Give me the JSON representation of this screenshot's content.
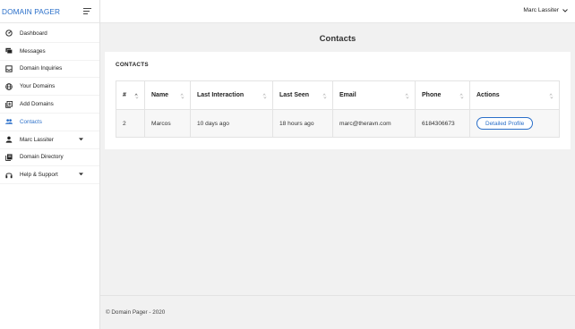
{
  "brand": {
    "name": "DOMAIN PAGER"
  },
  "sidebar": {
    "items": [
      {
        "label": "Dashboard",
        "icon": "dashboard-icon",
        "active": false,
        "has_caret": false
      },
      {
        "label": "Messages",
        "icon": "messages-icon",
        "active": false,
        "has_caret": false
      },
      {
        "label": "Domain Inquiries",
        "icon": "inquiries-icon",
        "active": false,
        "has_caret": false
      },
      {
        "label": "Your Domains",
        "icon": "globe-icon",
        "active": false,
        "has_caret": false
      },
      {
        "label": "Add Domains",
        "icon": "add-domain-icon",
        "active": false,
        "has_caret": false
      },
      {
        "label": "Contacts",
        "icon": "contacts-icon",
        "active": true,
        "has_caret": false
      },
      {
        "label": "Marc Lassiter",
        "icon": "user-icon",
        "active": false,
        "has_caret": true
      },
      {
        "label": "Domain Directory",
        "icon": "directory-icon",
        "active": false,
        "has_caret": false
      },
      {
        "label": "Help & Support",
        "icon": "headset-icon",
        "active": false,
        "has_caret": true
      }
    ]
  },
  "header": {
    "user_name": "Marc Lassiter"
  },
  "page": {
    "title": "Contacts"
  },
  "card": {
    "title": "CONTACTS"
  },
  "table": {
    "columns": [
      "#",
      "Name",
      "Last Interaction",
      "Last Seen",
      "Email",
      "Phone",
      "Actions"
    ],
    "rows": [
      {
        "num": "2",
        "name": "Marcos",
        "last_interaction": "10 days ago",
        "last_seen": "18 hours ago",
        "email": "marc@theravn.com",
        "phone": "6184306673",
        "action_label": "Detailed Profile"
      }
    ]
  },
  "footer": {
    "text": "© Domain Pager - 2020"
  },
  "colors": {
    "accent": "#2a6fc9",
    "page_background": "#f1f1f1",
    "row_background": "#f7f7f7"
  }
}
